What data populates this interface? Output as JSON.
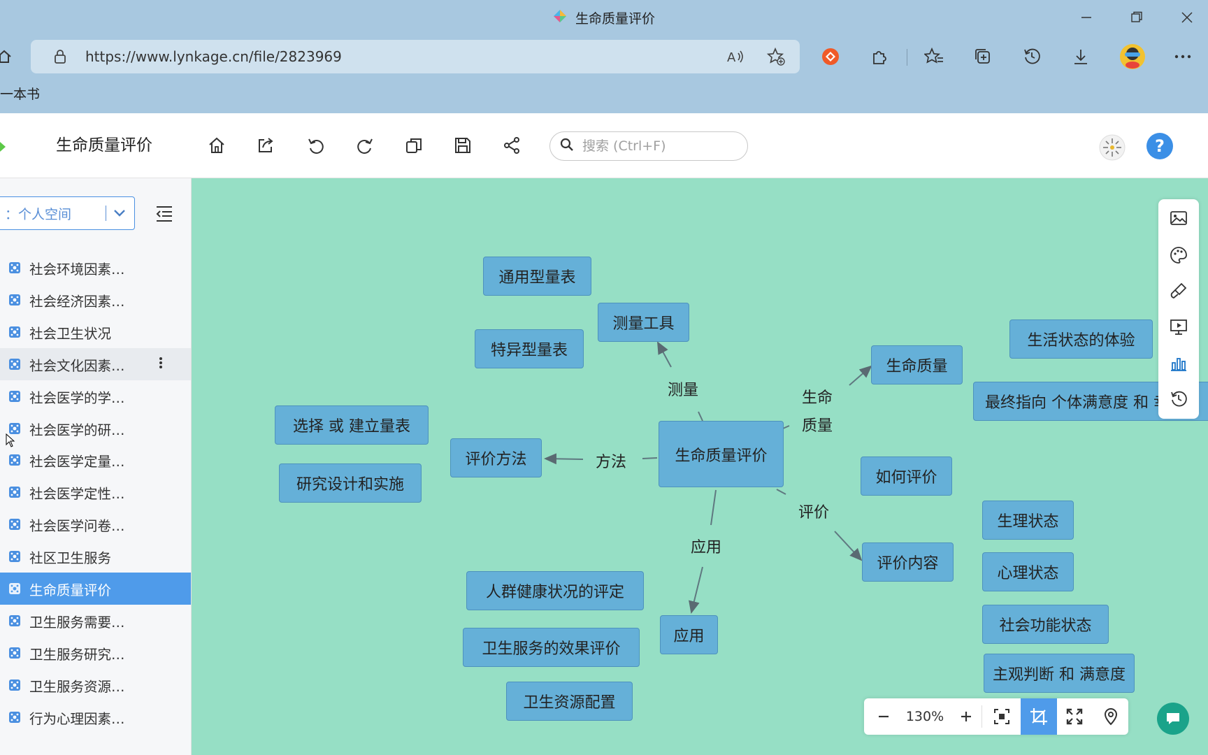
{
  "browser": {
    "title": "生命质量评价",
    "url": "https://www.lynkage.cn/file/2823969",
    "favorites_bar_text": "一本书"
  },
  "app": {
    "doc_title": "生命质量评价",
    "search_placeholder": "搜索 (Ctrl+F)"
  },
  "sidebar": {
    "space_label": "：个人空间",
    "items": [
      {
        "label": "社会环境因素…"
      },
      {
        "label": "社会经济因素…"
      },
      {
        "label": "社会卫生状况"
      },
      {
        "label": "社会文化因素…"
      },
      {
        "label": "社会医学的学…"
      },
      {
        "label": "社会医学的研…"
      },
      {
        "label": "社会医学定量…"
      },
      {
        "label": "社会医学定性…"
      },
      {
        "label": "社会医学问卷…"
      },
      {
        "label": "社区卫生服务"
      },
      {
        "label": "生命质量评价"
      },
      {
        "label": "卫生服务需要…"
      },
      {
        "label": "卫生服务研究…"
      },
      {
        "label": "卫生服务资源…"
      },
      {
        "label": "行为心理因素…"
      }
    ],
    "active_item": "生命质量评价",
    "hover_item": "社会文化因素…"
  },
  "mindmap": {
    "nodes": {
      "center": "生命质量评价",
      "tongyong": "通用型量表",
      "celianggongju": "测量工具",
      "teyi": "特异型量表",
      "shengmingzhiliang": "生命质量",
      "shenghuozhuangtai": "生活状态的体验",
      "zuizhong": "最终指向 个体满意度 和 幸福",
      "xuanze": "选择 或 建立量表",
      "pingjiafangfa": "评价方法",
      "yanjiu": "研究设计和实施",
      "ruhepingjia": "如何评价",
      "shenglizhuangtai": "生理状态",
      "xinlizhuangtai": "心理状态",
      "pingjianeirong": "评价内容",
      "shehuigongneng": "社会功能状态",
      "zhuguan": "主观判断 和 满意度",
      "renqun": "人群健康状况的评定",
      "yingyong_node": "应用",
      "weishengfuwu": "卫生服务的效果评价",
      "weishengziyuan": "卫生资源配置"
    },
    "edge_labels": {
      "celiang": "测量",
      "shengming_zhiliang": "生命\n质量",
      "fangfa": "方法",
      "pingjia": "评价",
      "yingyong": "应用"
    }
  },
  "zoom": {
    "level": "130%"
  },
  "colors": {
    "canvas_bg": "#96dfc5",
    "node_bg": "#65b0d8",
    "accent": "#4f9bea",
    "browser_bg": "#a8c8e0"
  }
}
